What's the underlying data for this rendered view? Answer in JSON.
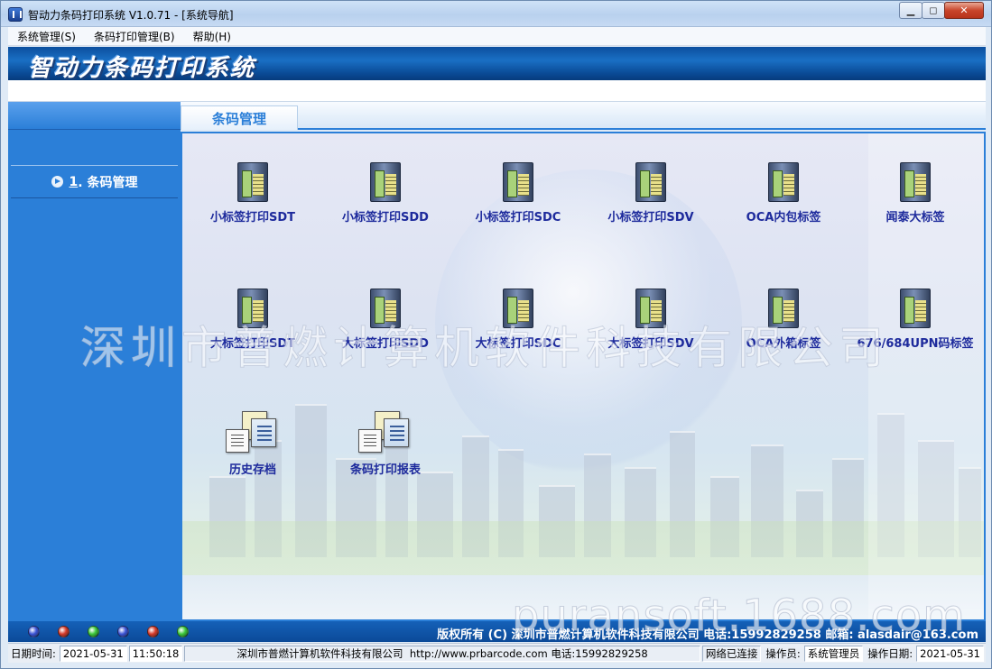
{
  "window": {
    "title": "智动力条码打印系统 V1.0.71 - [系统导航]",
    "controls": {
      "minimize": "▁",
      "restore": "◻",
      "close": "✕"
    }
  },
  "menu": [
    "系统管理(S)",
    "条码打印管理(B)",
    "帮助(H)"
  ],
  "banner": {
    "title": "智动力条码打印系统"
  },
  "sidebar": {
    "items": [
      {
        "number": "1",
        "label": ". 条码管理"
      }
    ]
  },
  "tabs": [
    {
      "label": "条码管理"
    }
  ],
  "tiles": {
    "row1": [
      "小标签打印SDT",
      "小标签打印SDD",
      "小标签打印SDC",
      "小标签打印SDV",
      "OCA内包标签",
      "闻泰大标签"
    ],
    "row2": [
      "大标签打印SDT",
      "大标签打印SDD",
      "大标签打印SDC",
      "大标签打印SDV",
      "OCA外箱标签",
      "676/684UPN码标签"
    ],
    "row3": [
      "历史存档",
      "条码打印报表"
    ]
  },
  "watermarks": {
    "company": "深圳市普燃计算机软件科技有限公司",
    "site": "puransoft.1688.com"
  },
  "footer": {
    "copyright": "版权所有 (C) 深圳市普燃计算机软件科技有限公司  电话:15992829258  邮箱: alasdair@163.com",
    "led_colors": [
      "#3a53d6",
      "#d63a2a",
      "#3ac83a",
      "#3a53d6",
      "#d63a2a",
      "#3ac83a"
    ]
  },
  "status": {
    "datetime_label": "日期时间:",
    "date": "2021-05-31",
    "time": "11:50:18",
    "company": "深圳市普燃计算机软件科技有限公司",
    "url": "http://www.prbarcode.com",
    "phone": "电话:15992829258",
    "network": "网络已连接",
    "operator_label": "操作员:",
    "operator": "系统管理员",
    "opdate_label": "操作日期:",
    "opdate": "2021-05-31"
  }
}
